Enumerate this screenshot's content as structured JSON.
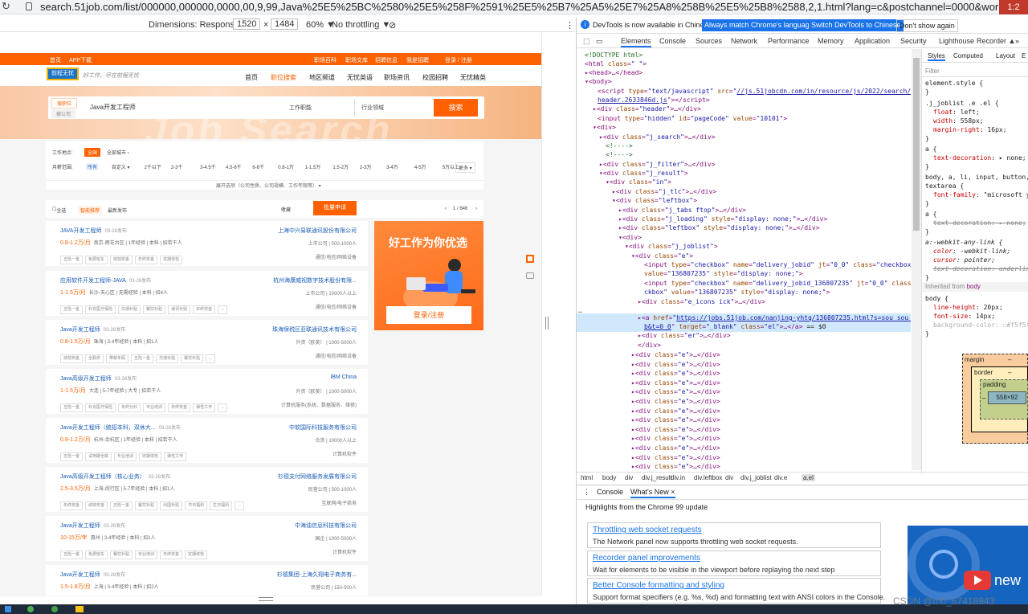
{
  "browser": {
    "url": "search.51job.com/list/000000,000000,0000,00,9,99,Java%25E5%25BC%2580%25E5%258F%2591%25E5%25B7%25A5%25E7%25A8%258B%25E5%25B8%2588,2,1.html?lang=c&postchannel=0000&workyear=99&cotype=99&degreefrom=",
    "extension_label": "1:2"
  },
  "device_toolbar": {
    "dimensions_label": "Dimensions: Responsive ▼",
    "width": "1520",
    "times": "×",
    "height": "1484",
    "zoom": "60% ▼",
    "throttle": "No throttling ▼"
  },
  "site": {
    "topnav": [
      "首页",
      "APP下载",
      "职场百科",
      "职场文库",
      "招聘信息",
      "我是招聘",
      "登录 / 注册"
    ],
    "logo_text": "前程无忧",
    "slogan": "好工作，尽在前程无忧",
    "nav": [
      "首页",
      "职位搜索",
      "地区频道",
      "无忧英语",
      "职场资讯",
      "校园招聘",
      "无忧精英"
    ],
    "banner_watermark": "Job Search",
    "search": {
      "tab_job": "搜职位",
      "tab_company": "搜公司",
      "keyword": "Java开发工程师",
      "category": "工作职能",
      "industry": "行业领域",
      "button": "搜索"
    },
    "filters": {
      "location_label": "工作地点:",
      "location_value": "全国",
      "location_more": "全部城市 ›",
      "salary_label": "月薪范围:",
      "salary_options": [
        "所有",
        "自定义 ▾",
        "2千以下",
        "2-3千",
        "3-4.5千",
        "4.5-6千",
        "6-8千",
        "0.8-1万",
        "1-1.5万",
        "1.5-2万",
        "2-3万",
        "3-4万",
        "4-5万",
        "5万以上"
      ],
      "more": "更多 ▾",
      "expand": "展开选项（公司性质、公司规模、工作年限等） ▾"
    },
    "toolbar": {
      "select_all": "全选",
      "sort_smart": "智能推荐",
      "sort_latest": "最新发布",
      "favorite": "收藏",
      "batch_apply": "批量申请",
      "pagination": "1 / 646"
    },
    "jobs": [
      {
        "title": "JAVA开发工程师",
        "date": "03-28发布",
        "company": "上海中兴易联通讯股份有限公司",
        "salary": "0.8-1.2万/月",
        "meta": "南京-雨花台区 | 1年经验 | 本科 | 招若干人",
        "company_info": "上市公司 | 500-1000人",
        "tags": [
          "五险一金",
          "免费班车",
          "绩效奖金",
          "年终奖金",
          "定期体检"
        ],
        "industry": "通信/电信/网络设备"
      },
      {
        "title": "应用软件开发工程师-JAVA",
        "date": "03-28发布",
        "company": "杭州海康威视数字技术股份有限...",
        "salary": "1-1.5万/月",
        "meta": "长沙-天心区 | 无需经验 | 本科 | 招4人",
        "company_info": "上市公司 | 10000人以上",
        "tags": [
          "五险一金",
          "补充医疗保险",
          "交通补贴",
          "餐饮补贴",
          "通讯补贴",
          "年终奖金",
          "..."
        ],
        "industry": "通信/电信/网络设备"
      },
      {
        "title": "Java开发工程师",
        "date": "03-28发布",
        "company": "珠海保税区亚联通讯技术有限公司",
        "salary": "0.8-1.5万/月",
        "meta": "珠海 | 3-4年经验 | 本科 | 招1人",
        "company_info": "外资（欧美） | 1000-5000人",
        "tags": [
          "绩效奖金",
          "全勤奖",
          "带薪年假",
          "五险一金",
          "交通补贴",
          "餐饮补贴",
          "..."
        ],
        "industry": "通信/电信/网络设备"
      },
      {
        "title": "Java高级开发工程师",
        "date": "03-28发布",
        "company": "IBM China",
        "salary": "1-1.5万/月",
        "meta": "大连 | 5-7年经验 | 大专 | 招若干人",
        "company_info": "外资（欧美） | 1000-5000人",
        "tags": [
          "五险一金",
          "补充医疗保险",
          "年终分红",
          "专业培训",
          "年终奖金",
          "弹性工作",
          "..."
        ],
        "industry": "计算机服务(系统、数据服务、维修)"
      },
      {
        "title": "Java开发工程师（统招本科，双休大...",
        "date": "03-28发布",
        "company": "中软国际科技服务有限公司",
        "salary": "0.9-1.2万/月",
        "meta": "杭州-余杭区 | 1年经验 | 本科 | 招若干人",
        "company_info": "合资 | 10000人以上",
        "tags": [
          "五险一金",
          "试用期全薪",
          "专业培训",
          "定期体检",
          "弹性工作"
        ],
        "industry": "计算机软件"
      },
      {
        "title": "Java高级开发工程师（核心业务）",
        "date": "03-28发布",
        "company": "杉德支付网络服务发展有限公司",
        "salary": "2.5-3.5万/月",
        "meta": "上海-闵行区 | 5-7年经验 | 本科 | 招1人",
        "company_info": "民营公司 | 500-1000人",
        "tags": [
          "年终奖金",
          "绩效奖金",
          "五险一金",
          "餐饮补贴",
          "出国补贴",
          "节日福利",
          "生日福利",
          "..."
        ],
        "industry": "互联网/电子商务"
      },
      {
        "title": "Java开发工程师",
        "date": "03-28发布",
        "company": "中海油信息科技有限公司",
        "salary": "10-15万/年",
        "meta": "惠州 | 3-4年经验 | 本科 | 招1人",
        "company_info": "国企 | 1000-5000人",
        "tags": [
          "五险一金",
          "免费班车",
          "餐饮补贴",
          "专业培训",
          "年终奖金",
          "定期体检"
        ],
        "industry": "计算机软件"
      },
      {
        "title": "Java开发工程师",
        "date": "03-28发布",
        "company": "杉德集团-上海久翔电子商务有...",
        "salary": "1.5-1.8万/月",
        "meta": "上海 | 3-4年经验 | 本科 | 招2人",
        "company_info": "民营公司 | 150-500人",
        "tags": [],
        "industry": ""
      }
    ],
    "ad": {
      "headline": "好工作为你优选",
      "button": "登录/注册"
    }
  },
  "devtools": {
    "info_text": "DevTools is now available in Chinese!",
    "btn_match": "Always match Chrome's language",
    "btn_switch": "Switch DevTools to Chinese",
    "dont_show": "Don't show again",
    "tabs": [
      "Elements",
      "Console",
      "Sources",
      "Network",
      "Performance",
      "Memory",
      "Application",
      "Security",
      "Lighthouse",
      "Recorder ▲"
    ],
    "styles_tabs": [
      "Styles",
      "Computed",
      "Layout",
      "E"
    ],
    "filter_placeholder": "Filter",
    "breadcrumbs": [
      "html",
      "body",
      "div",
      "div.j_result",
      "div.in",
      "div.leftbox",
      "div",
      "div.j_joblist",
      "div.e",
      "a.el"
    ],
    "box_model": {
      "margin": "margin",
      "border": "border",
      "padding": "padding",
      "content": "558×92",
      "dash": "–"
    },
    "drawer_tabs": [
      "Console",
      "What's New ×"
    ],
    "highlights": "Highlights from the Chrome 99 update",
    "cards": [
      {
        "title": "Throttling web socket requests",
        "desc": "The Network panel now supports throttling web socket requests."
      },
      {
        "title": "Recorder panel improvements",
        "desc": "Wait for elements to be visible in the viewport before replaying the next step"
      },
      {
        "title": "Better Console formatting and styling",
        "desc": "Support format specifiers (e.g. %s, %d) and formatting text with ANSI colors in the Console."
      }
    ],
    "video_label": "new"
  },
  "watermark": "CSDN @m0_67418943"
}
